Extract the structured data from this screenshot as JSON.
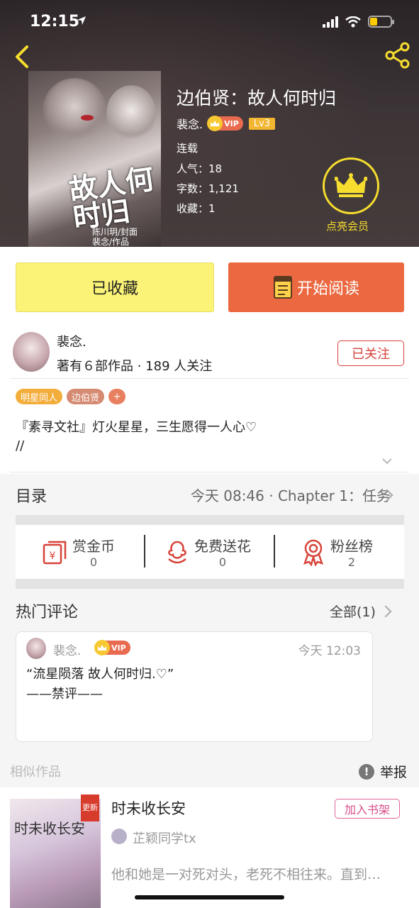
{
  "status_bar": {
    "time": "12:15"
  },
  "book": {
    "title": "边伯贤：故人何时归",
    "author": "裴念.",
    "vip_label": "VIP",
    "level": "Lv3",
    "status": "连载",
    "popularity": "人气：18",
    "word_count": "字数：1,121",
    "favorites": "收藏：1",
    "cover_title": "故人何时归",
    "cover_credits": "陈川玥/封面\n裴念/作品",
    "member_label": "点亮会员"
  },
  "actions": {
    "favorited_label": "已收藏",
    "read_label": "开始阅读"
  },
  "author_info": {
    "name": "裴念.",
    "stats": "著有６部作品 · 189 人关注",
    "follow_label": "已关注",
    "tags": [
      "明星同人",
      "边伯贤",
      "+"
    ],
    "description_line1": "『素寻文社』灯火星星，三生愿得一人心♡",
    "description_line2": "//"
  },
  "catalog": {
    "title": "目录",
    "latest": "今天 08:46 · Chapter 1：任务"
  },
  "rewards": [
    {
      "label": "赏金币",
      "value": "0",
      "icon": "red-envelope-icon"
    },
    {
      "label": "免费送花",
      "value": "0",
      "icon": "flower-icon"
    },
    {
      "label": "粉丝榜",
      "value": "2",
      "icon": "medal-icon"
    }
  ],
  "comments": {
    "title": "热门评论",
    "all_label": "全部(1)",
    "items": [
      {
        "author": "裴念.",
        "vip": "VIP",
        "time": "今天 12:03",
        "text": "“流星陨落 故人何时归.♡”\n——禁评——"
      }
    ]
  },
  "similar": {
    "title": "相似作品",
    "report_label": "举报",
    "items": [
      {
        "title": "时未收长安",
        "author": "芷颖同学tx",
        "desc": "他和她是一对死对头，老死不相往来。直到…",
        "badge": "更新",
        "add_label": "加入书架",
        "cover_text": "时未收长安"
      }
    ]
  },
  "colors": {
    "accent_orange": "#eb6840",
    "favorite_yellow": "#fbf377",
    "member_gold": "#f7de2e",
    "follow_red": "#d6413b"
  }
}
